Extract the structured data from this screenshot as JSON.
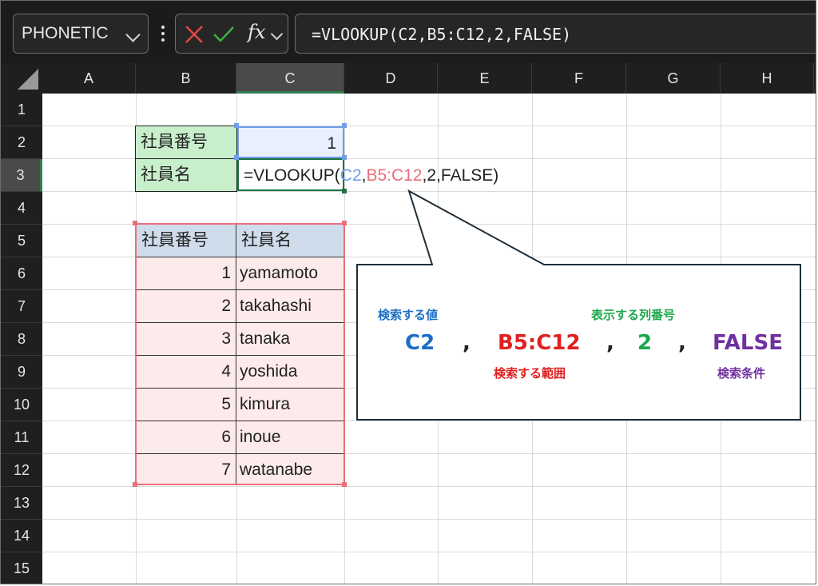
{
  "name_box": {
    "value": "PHONETIC"
  },
  "formula_bar": {
    "formula": "=VLOOKUP(C2,B5:C12,2,FALSE)",
    "fx_label": "fx"
  },
  "columns": [
    "A",
    "B",
    "C",
    "D",
    "E",
    "F",
    "G",
    "H"
  ],
  "rows": [
    "1",
    "2",
    "3",
    "4",
    "5",
    "6",
    "7",
    "8",
    "9",
    "10",
    "11",
    "12",
    "13",
    "14",
    "15"
  ],
  "lookup": {
    "id_label": "社員番号",
    "id_value": "1",
    "name_label": "社員名",
    "formula_parts": {
      "prefix": "=VLOOKUP(",
      "arg1": "C2",
      "comma": ",",
      "arg2": "B5:C12",
      "rest": ",2,FALSE)"
    }
  },
  "table": {
    "headers": [
      "社員番号",
      "社員名"
    ],
    "rows": [
      {
        "id": "1",
        "name": "yamamoto"
      },
      {
        "id": "2",
        "name": "takahashi"
      },
      {
        "id": "3",
        "name": "tanaka"
      },
      {
        "id": "4",
        "name": "yoshida"
      },
      {
        "id": "5",
        "name": "kimura"
      },
      {
        "id": "6",
        "name": "inoue"
      },
      {
        "id": "7",
        "name": "watanabe"
      }
    ]
  },
  "callout": {
    "arg1_caption": "検索する値",
    "arg1": "C2",
    "arg2": "B5:C12",
    "arg2_caption": "検索する範囲",
    "arg3_caption": "表示する列番号",
    "arg3": "2",
    "arg4": "FALSE",
    "arg4_caption": "検索条件",
    "separator": ","
  },
  "colors": {
    "blue": "#1a6fc4",
    "red": "#e02020",
    "green": "#1aa84a",
    "purple": "#7030a0",
    "range_blue": "#6d9ee8",
    "range_red": "#e8707a",
    "selection_green": "#217346"
  }
}
